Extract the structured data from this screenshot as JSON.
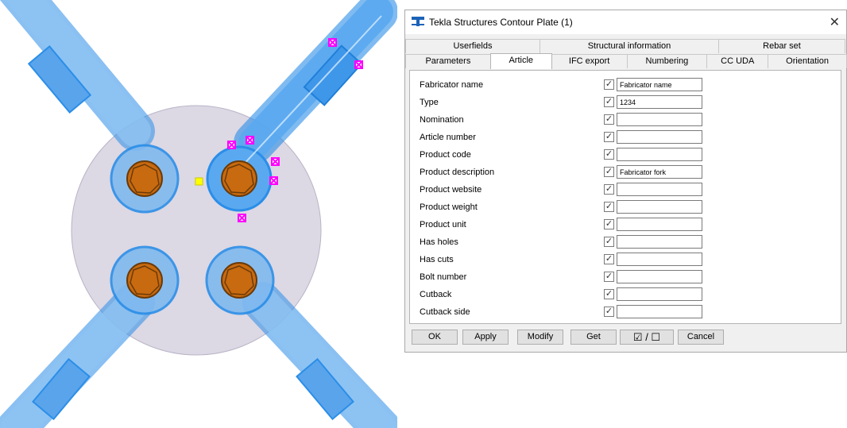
{
  "window": {
    "title": "Tekla Structures  Contour Plate (1)",
    "close_glyph": "✕"
  },
  "tabs_top": [
    {
      "label": "Userfields"
    },
    {
      "label": "Structural information"
    },
    {
      "label": "Rebar set"
    }
  ],
  "tabs_bottom": [
    {
      "label": "Parameters",
      "active": false
    },
    {
      "label": "Article",
      "active": true
    },
    {
      "label": "IFC export",
      "active": false
    },
    {
      "label": "Numbering",
      "active": false
    },
    {
      "label": "CC UDA",
      "active": false
    },
    {
      "label": "Orientation",
      "active": false
    }
  ],
  "fields": [
    {
      "label": "Fabricator name",
      "value": "Fabricator name",
      "checked": true
    },
    {
      "label": "Type",
      "value": "1234",
      "checked": true
    },
    {
      "label": "Nomination",
      "value": "",
      "checked": true
    },
    {
      "label": "Article number",
      "value": "",
      "checked": true
    },
    {
      "label": "Product code",
      "value": "",
      "checked": true
    },
    {
      "label": "Product description",
      "value": "Fabricator fork",
      "checked": true
    },
    {
      "label": "Product website",
      "value": "",
      "checked": true
    },
    {
      "label": "Product weight",
      "value": "",
      "checked": true
    },
    {
      "label": "Product unit",
      "value": "",
      "checked": true
    },
    {
      "label": "Has holes",
      "value": "",
      "checked": true
    },
    {
      "label": "Has cuts",
      "value": "",
      "checked": true
    },
    {
      "label": "Bolt number",
      "value": "",
      "checked": true
    },
    {
      "label": "Cutback",
      "value": "",
      "checked": true
    },
    {
      "label": "Cutback side",
      "value": "",
      "checked": true
    }
  ],
  "buttons": {
    "ok": "OK",
    "apply": "Apply",
    "modify": "Modify",
    "get": "Get",
    "toggle": "☑ / ☐",
    "cancel": "Cancel"
  },
  "colors": {
    "base_plate": "#dcd8e4",
    "member": "#7fb9ef",
    "member_stroke": "#2b8ee8",
    "bolt": "#c86a10",
    "handle": "#ff00ff",
    "reference_point": "#ffff00"
  }
}
